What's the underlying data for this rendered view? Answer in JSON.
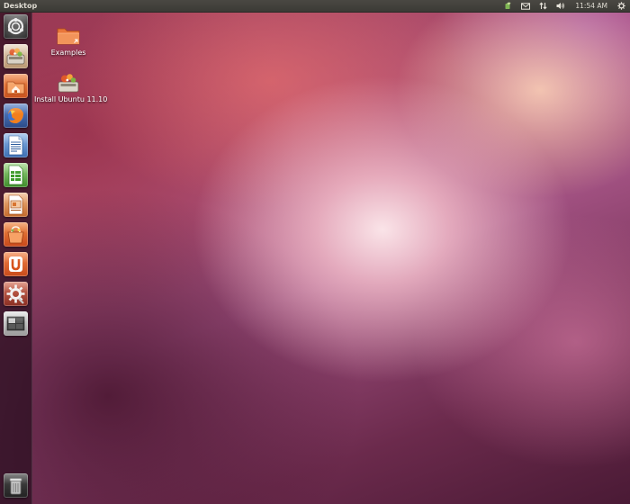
{
  "top_panel": {
    "title": "Desktop",
    "clock": "11:54 AM",
    "indicators": [
      "messaging-icon",
      "mail-icon",
      "network-icon",
      "volume-icon",
      "session-gear-icon"
    ]
  },
  "launcher": {
    "items": [
      {
        "name": "dash-home",
        "icon": "ubuntu-logo-icon"
      },
      {
        "name": "install-ubuntu",
        "icon": "installer-icon"
      },
      {
        "name": "home-folder",
        "icon": "home-folder-icon"
      },
      {
        "name": "firefox",
        "icon": "firefox-icon"
      },
      {
        "name": "libreoffice-writer",
        "icon": "writer-icon"
      },
      {
        "name": "libreoffice-calc",
        "icon": "calc-icon"
      },
      {
        "name": "libreoffice-impress",
        "icon": "impress-icon"
      },
      {
        "name": "software-center",
        "icon": "software-center-icon"
      },
      {
        "name": "ubuntu-one",
        "icon": "ubuntu-one-icon"
      },
      {
        "name": "system-settings",
        "icon": "settings-icon"
      },
      {
        "name": "workspace-switcher",
        "icon": "workspace-switcher-icon"
      },
      {
        "name": "trash",
        "icon": "trash-icon"
      }
    ]
  },
  "desktop": {
    "icons": [
      {
        "label": "Examples",
        "icon": "folder-icon"
      },
      {
        "label": "Install Ubuntu 11.10",
        "icon": "installer-icon"
      }
    ]
  }
}
